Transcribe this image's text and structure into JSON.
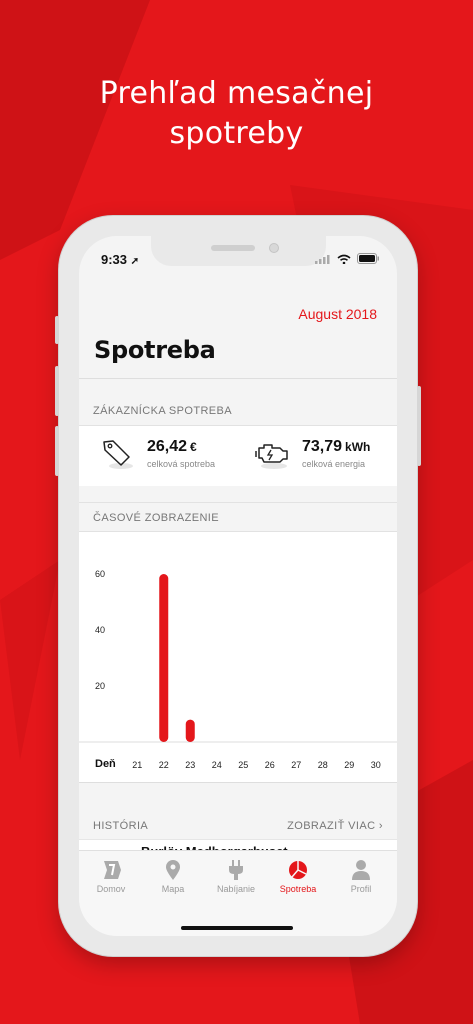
{
  "headline": {
    "line1": "Prehľad mesačnej",
    "line2": "spotreby"
  },
  "status": {
    "time": "9:33"
  },
  "month": "August 2018",
  "title": "Spotreba",
  "customer_section": {
    "header": "ZÁKAZNÍCKA SPOTREBA",
    "cost": {
      "value": "26,42",
      "unit": "€",
      "label": "celková spotreba"
    },
    "energy": {
      "value": "73,79",
      "unit": "kWh",
      "label": "celková energia"
    }
  },
  "time_section": {
    "header": "ČASOVÉ ZOBRAZENIE"
  },
  "chart_data": {
    "type": "bar",
    "xlabel": "Deň",
    "categories": [
      "21",
      "22",
      "23",
      "24",
      "25",
      "26",
      "27",
      "28",
      "29",
      "30"
    ],
    "values": [
      0,
      60,
      8,
      0,
      0,
      0,
      0,
      0,
      0,
      0
    ],
    "yticks": [
      20,
      40,
      60
    ],
    "ylim": [
      0,
      60
    ],
    "grid": false,
    "bar_color": "#e4171b"
  },
  "history": {
    "header": "HISTÓRIA",
    "more": "ZOBRAZIŤ VIAC",
    "items": [
      {
        "title": "Burlöv Medborgarhuset"
      }
    ]
  },
  "tabs": [
    {
      "label": "Domov",
      "icon": "logo-icon",
      "active": false
    },
    {
      "label": "Mapa",
      "icon": "map-pin-icon",
      "active": false
    },
    {
      "label": "Nabíjanie",
      "icon": "plug-icon",
      "active": false
    },
    {
      "label": "Spotreba",
      "icon": "pie-chart-icon",
      "active": true
    },
    {
      "label": "Profil",
      "icon": "user-icon",
      "active": false
    }
  ],
  "colors": {
    "accent": "#e4171b",
    "background": "#f4f4f4"
  }
}
